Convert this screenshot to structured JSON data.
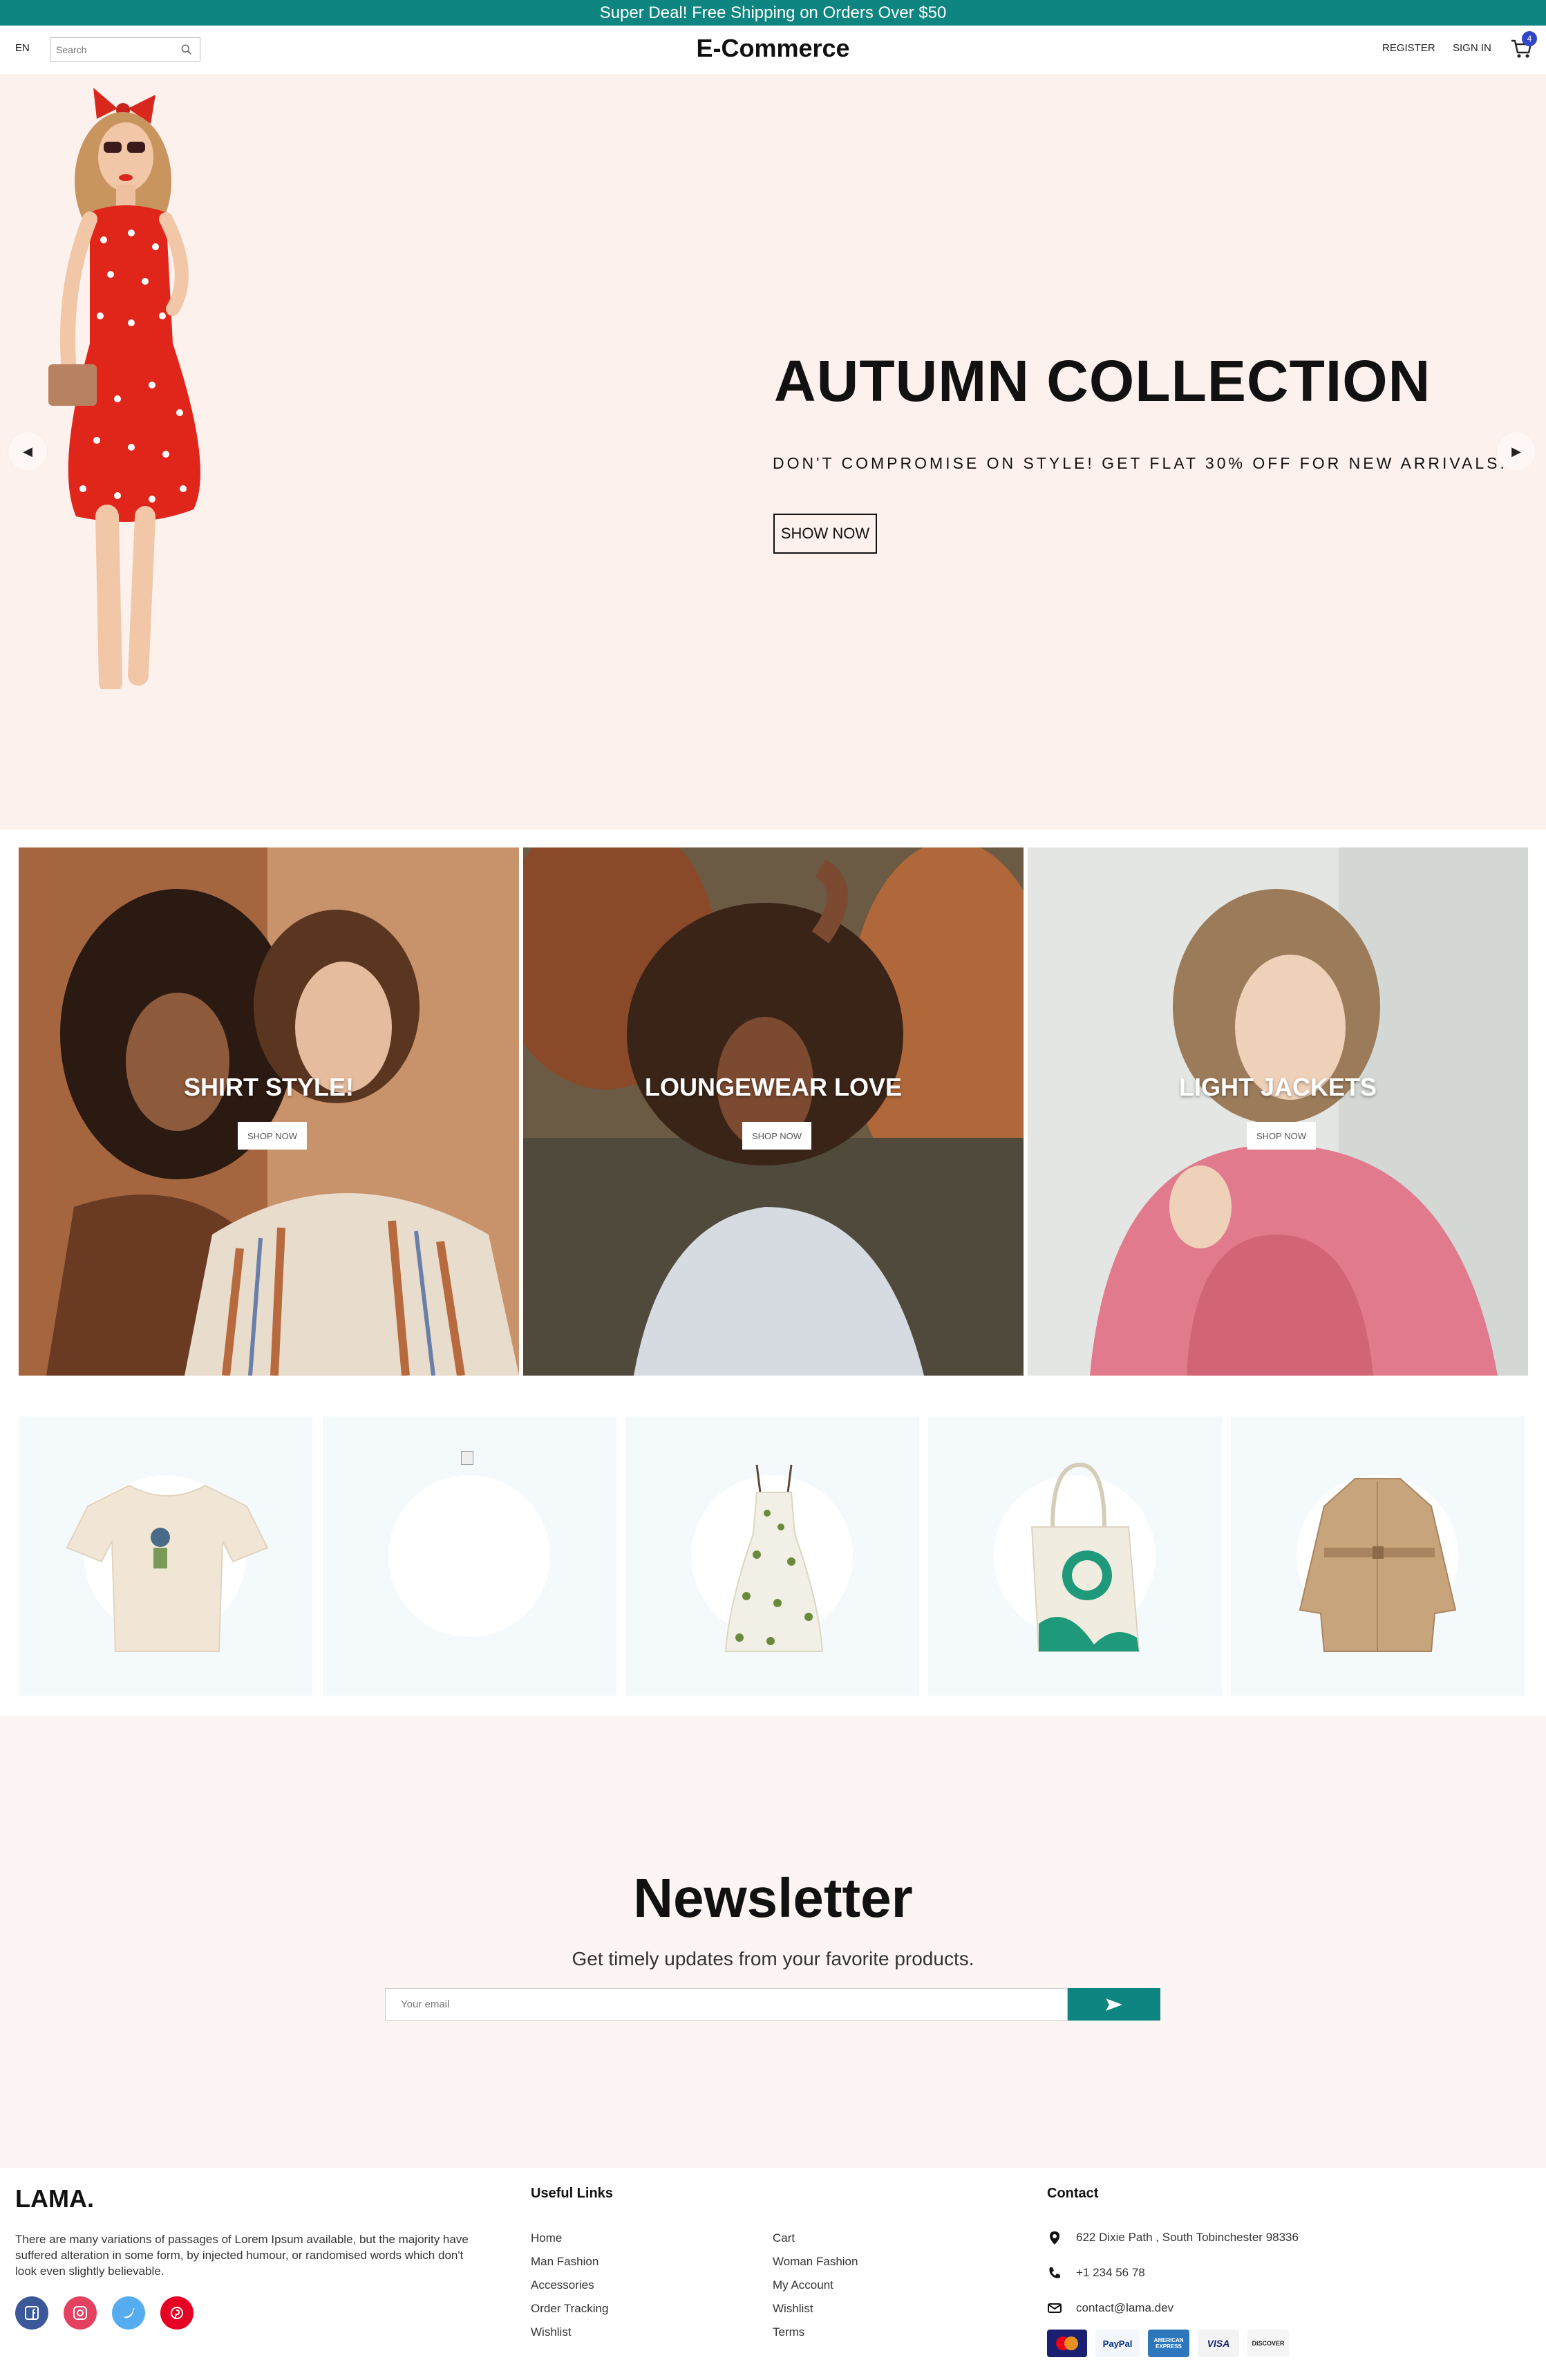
{
  "announcement": "Super Deal! Free Shipping on Orders Over $50",
  "nav": {
    "language": "EN",
    "search_placeholder": "Search",
    "logo": "E-Commerce",
    "register": "REGISTER",
    "sign_in": "SIGN IN",
    "cart_count": "4"
  },
  "hero": {
    "title": "AUTUMN COLLECTION",
    "description": "DON'T COMPROMISE ON STYLE! GET FLAT 30% OFF FOR NEW ARRIVALS.",
    "button": "SHOW NOW"
  },
  "categories": [
    {
      "title": "SHIRT STYLE!",
      "button": "SHOP NOW"
    },
    {
      "title": "LOUNGEWEAR LOVE",
      "button": "SHOP NOW"
    },
    {
      "title": "LIGHT JACKETS",
      "button": "SHOP NOW"
    }
  ],
  "products": [
    {
      "icon": "tshirt-image"
    },
    {
      "icon": "broken-image"
    },
    {
      "icon": "dress-image"
    },
    {
      "icon": "tote-bag-image"
    },
    {
      "icon": "trench-coat-image"
    }
  ],
  "newsletter": {
    "title": "Newsletter",
    "description": "Get timely updates from your favorite products.",
    "placeholder": "Your email"
  },
  "footer": {
    "logo": "LAMA.",
    "description": "There are many variations of passages of Lorem Ipsum available, but the majority have suffered alteration in some form, by injected humour, or randomised words which don't look even slightly believable.",
    "useful_links_title": "Useful Links",
    "links_col1": [
      "Home",
      "Man Fashion",
      "Accessories",
      "Order Tracking",
      "Wishlist"
    ],
    "links_col2": [
      "Cart",
      "Woman Fashion",
      "My Account",
      "Wishlist",
      "Terms"
    ],
    "contact_title": "Contact",
    "address": "622 Dixie Path , South Tobinchester 98336",
    "phone": "+1 234 56 78",
    "email": "contact@lama.dev",
    "payments": [
      "MasterCard",
      "PayPal",
      "AMERICAN EXPRESS",
      "VISA",
      "DISCOVER"
    ]
  },
  "colors": {
    "teal": "#0e8580",
    "hero_bg": "#fcf1ed",
    "newsletter_bg": "#fcf5f3",
    "product_bg": "#f4fafc",
    "badge": "#3246c8"
  }
}
